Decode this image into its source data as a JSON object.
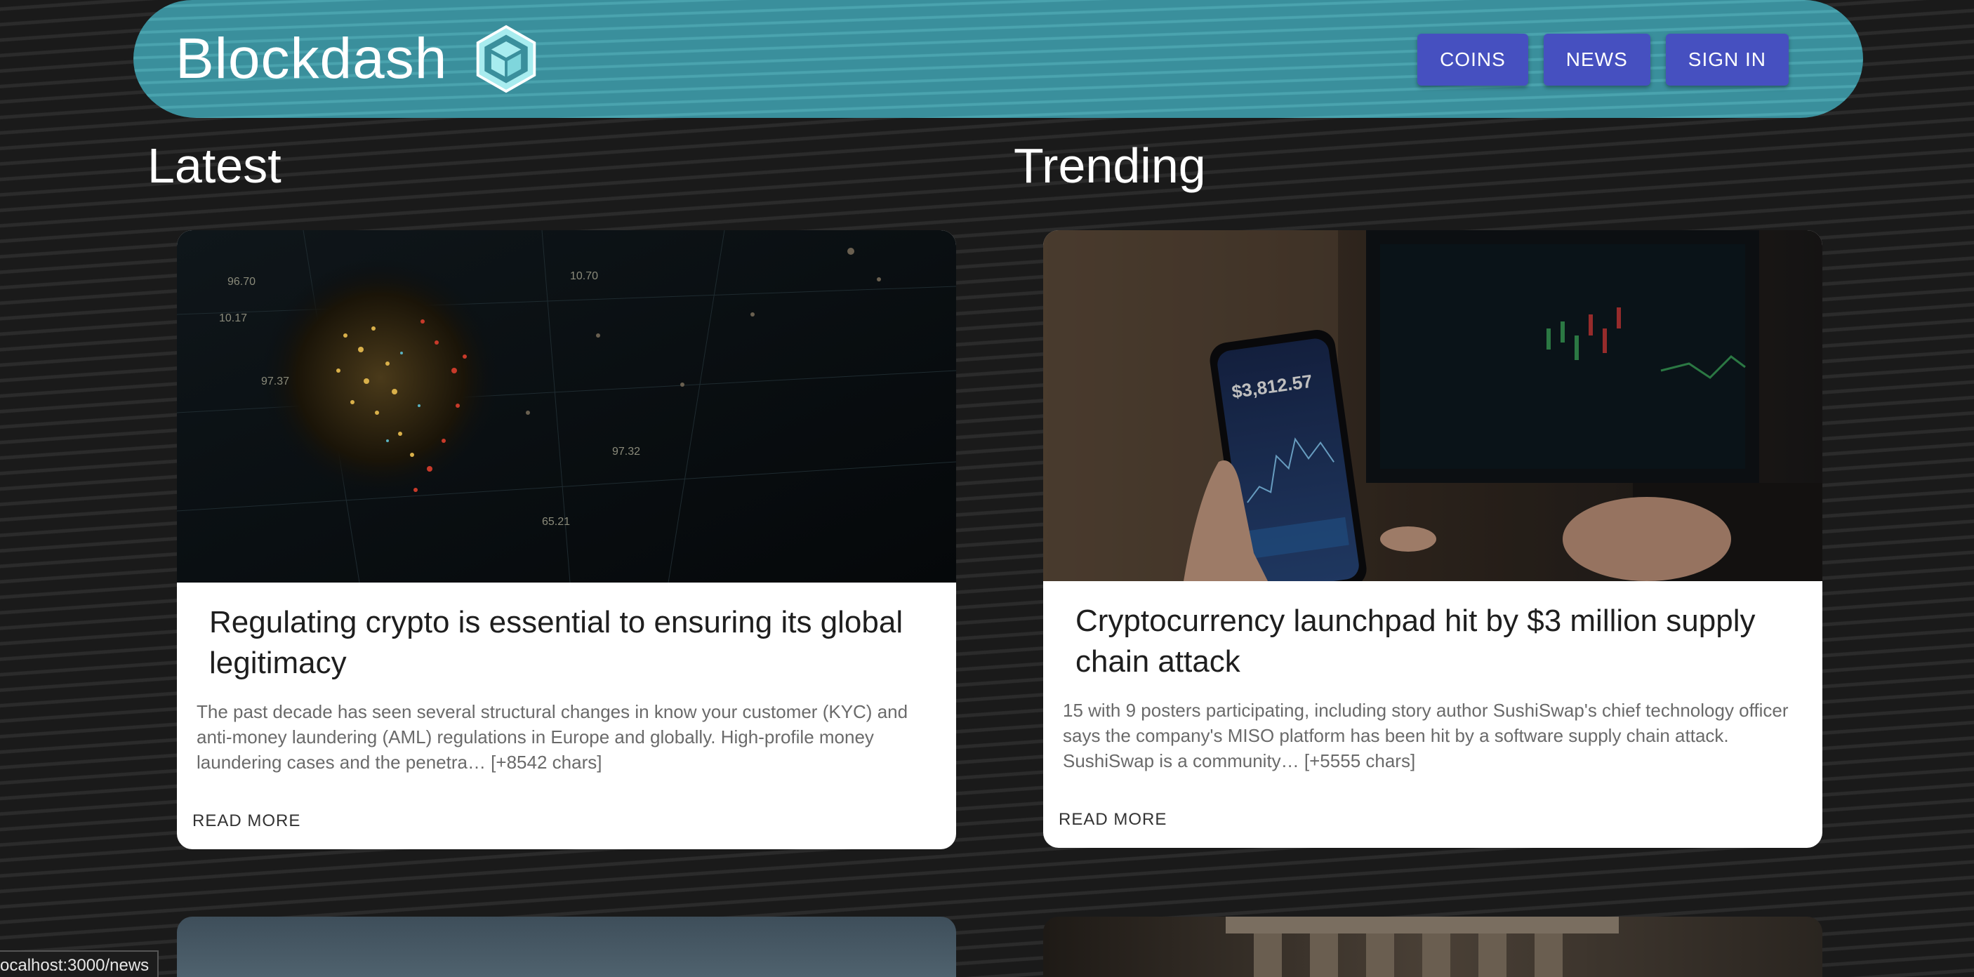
{
  "header": {
    "brand": "Blockdash",
    "logo_icon": "cube-logo-icon",
    "nav": [
      {
        "label": "COINS"
      },
      {
        "label": "NEWS"
      },
      {
        "label": "SIGN IN"
      }
    ]
  },
  "sections": {
    "latest": {
      "title": "Latest",
      "card": {
        "title": "Regulating crypto is essential to ensuring its global legitimacy",
        "description": "The past decade has seen several structural changes in know your customer (KYC) and anti-money laundering (AML) regulations in Europe and globally. High-profile money laundering cases and the penetra… [+8542 chars]",
        "read_more": "READ MORE"
      }
    },
    "trending": {
      "title": "Trending",
      "card": {
        "title": "Cryptocurrency launchpad hit by $3 million supply chain attack",
        "description": "15 with 9 posters participating, including story author SushiSwap's chief technology officer says the company's MISO platform has been hit by a software supply chain attack. SushiSwap is a community… [+5555 chars]",
        "read_more": "READ MORE",
        "image_phone_price": "$3,812.57"
      }
    }
  },
  "status_bar": {
    "url": "ocalhost:3000/news"
  },
  "colors": {
    "header": "#3a8f9c",
    "nav_button": "#4650c0",
    "background": "#141414"
  }
}
